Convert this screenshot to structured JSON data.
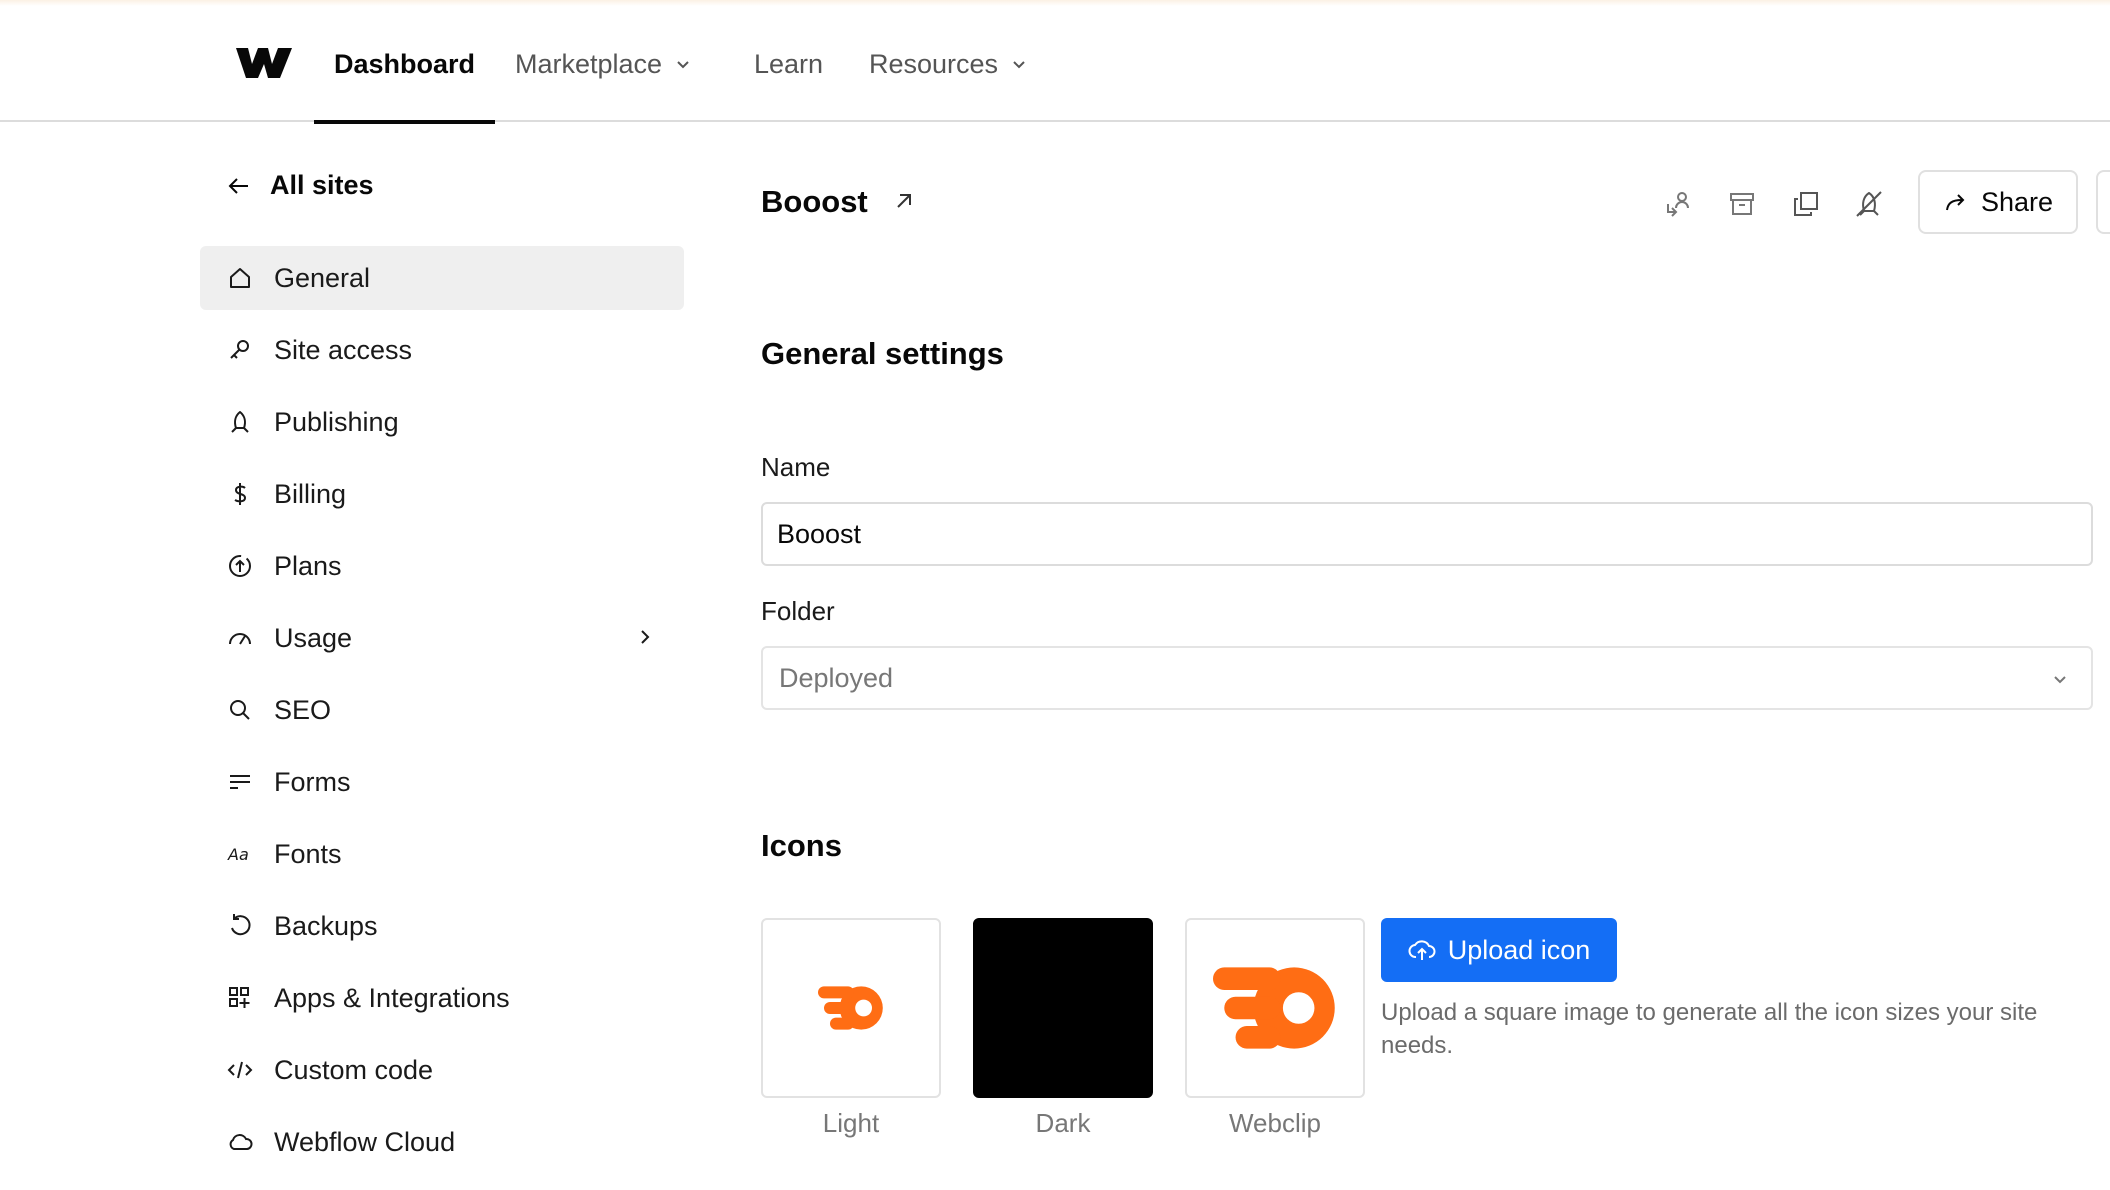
{
  "nav": {
    "items": [
      {
        "label": "Dashboard",
        "active": true
      },
      {
        "label": "Marketplace",
        "dropdown": true
      },
      {
        "label": "Learn"
      },
      {
        "label": "Resources",
        "dropdown": true
      }
    ]
  },
  "sidebar": {
    "back_label": "All sites",
    "items": [
      {
        "label": "General",
        "icon": "home-icon",
        "active": true
      },
      {
        "label": "Site access",
        "icon": "key-icon"
      },
      {
        "label": "Publishing",
        "icon": "rocket-icon"
      },
      {
        "label": "Billing",
        "icon": "dollar-icon"
      },
      {
        "label": "Plans",
        "icon": "plans-icon"
      },
      {
        "label": "Usage",
        "icon": "gauge-icon",
        "has_submenu": true
      },
      {
        "label": "SEO",
        "icon": "search-icon"
      },
      {
        "label": "Forms",
        "icon": "forms-icon"
      },
      {
        "label": "Fonts",
        "icon": "fonts-icon"
      },
      {
        "label": "Backups",
        "icon": "backup-icon"
      },
      {
        "label": "Apps & Integrations",
        "icon": "apps-icon"
      },
      {
        "label": "Custom code",
        "icon": "code-icon"
      },
      {
        "label": "Webflow Cloud",
        "icon": "cloud-icon"
      }
    ]
  },
  "header": {
    "site_name": "Booost",
    "share_label": "Share"
  },
  "general": {
    "heading": "General settings",
    "name_label": "Name",
    "name_value": "Booost",
    "folder_label": "Folder",
    "folder_value": "Deployed"
  },
  "icons": {
    "heading": "Icons",
    "tiles": [
      {
        "label": "Light"
      },
      {
        "label": "Dark"
      },
      {
        "label": "Webclip"
      }
    ],
    "upload_label": "Upload icon",
    "upload_help": "Upload a square image to generate all the icon sizes your site needs."
  },
  "colors": {
    "accent": "#146ef5",
    "brand_orange": "#ff6d14",
    "text": "#080808"
  }
}
